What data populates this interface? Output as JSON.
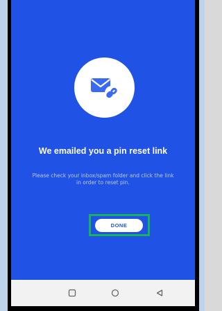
{
  "screen": {
    "title": "We emailed you a pin reset link",
    "message": "Please check your inbox/spam folder and click the link in order to reset pin.",
    "done_label": "DONE",
    "icon": "envelope-link-icon",
    "colors": {
      "background": "#2052e6",
      "accent_text": "#2052e6",
      "highlight_border": "#16b35c"
    }
  },
  "navbar": {
    "icons": [
      "recents-square-icon",
      "home-circle-icon",
      "back-triangle-icon"
    ]
  }
}
